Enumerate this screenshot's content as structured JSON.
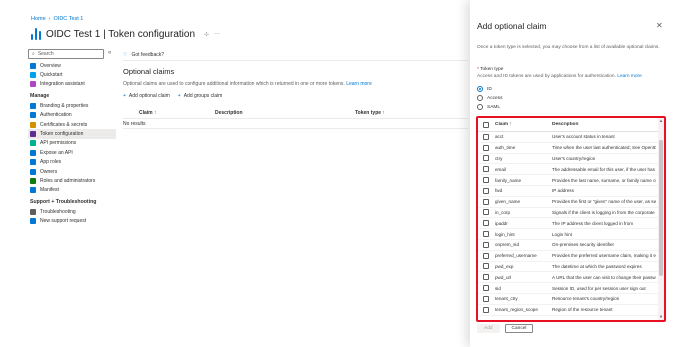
{
  "breadcrumb": [
    "Home",
    "OIDC Test 1"
  ],
  "page": {
    "app_name": "OIDC Test 1",
    "separator": "|",
    "section": "Token configuration",
    "pin_glyph": "⊹",
    "more_glyph": "···"
  },
  "sidebar": {
    "search_placeholder": "Search",
    "collapse_glyph": "«",
    "top_items": [
      {
        "label": "Overview",
        "color": "#0078d4"
      },
      {
        "label": "Quickstart",
        "color": "#00a2ed"
      },
      {
        "label": "Integration assistant",
        "color": "#b146c2"
      }
    ],
    "manage_label": "Manage",
    "manage_items": [
      {
        "label": "Branding & properties",
        "color": "#0078d4"
      },
      {
        "label": "Authentication",
        "color": "#0078d4"
      },
      {
        "label": "Certificates & secrets",
        "color": "#d29200"
      },
      {
        "label": "Token configuration",
        "color": "#5c2d91",
        "active": true
      },
      {
        "label": "API permissions",
        "color": "#00b294"
      },
      {
        "label": "Expose an API",
        "color": "#0078d4"
      },
      {
        "label": "App roles",
        "color": "#0078d4"
      },
      {
        "label": "Owners",
        "color": "#0078d4"
      },
      {
        "label": "Roles and administrators",
        "color": "#107c10"
      },
      {
        "label": "Manifest",
        "color": "#0078d4"
      }
    ],
    "support_label": "Support + Troubleshooting",
    "support_items": [
      {
        "label": "Troubleshooting",
        "color": "#605e5c"
      },
      {
        "label": "New support request",
        "color": "#0078d4"
      }
    ]
  },
  "main": {
    "feedback_label": "Got feedback?",
    "title": "Optional claims",
    "description": "Optional claims are used to configure additional information which is returned in one or more tokens.",
    "learn_more": "Learn more",
    "add_claim": "Add optional claim",
    "add_groups": "Add groups claim",
    "columns": [
      "Claim ↑",
      "Description",
      "Token type ↑"
    ],
    "empty_text": "No results"
  },
  "panel": {
    "title": "Add optional claim",
    "close_glyph": "✕",
    "description": "Once a token type is selected, you may choose from a list of available optional claims.",
    "token_type_label": "Token type",
    "token_type_help": "Access and ID tokens are used by applications for authentication.",
    "learn_more": "Learn more",
    "token_types": [
      {
        "label": "ID",
        "checked": true
      },
      {
        "label": "Access",
        "checked": false
      },
      {
        "label": "SAML",
        "checked": false
      }
    ],
    "claims_header": {
      "claim": "Claim ↑",
      "description": "Description"
    },
    "claims": [
      {
        "name": "acct",
        "description": "User's account status in tenant"
      },
      {
        "name": "auth_time",
        "description": "Time when the user last authenticated; See OpenID Con..."
      },
      {
        "name": "ctry",
        "description": "User's country/region"
      },
      {
        "name": "email",
        "description": "The addressable email for this user, if the user has one"
      },
      {
        "name": "family_name",
        "description": "Provides the last name, surname, or family name of the ..."
      },
      {
        "name": "fwd",
        "description": "IP address"
      },
      {
        "name": "given_name",
        "description": "Provides the first or \"given\" name of the user, as set on..."
      },
      {
        "name": "in_corp",
        "description": "Signals if the client is logging in from the corporate net..."
      },
      {
        "name": "ipaddr",
        "description": "The IP address the client logged in from"
      },
      {
        "name": "login_hint",
        "description": "Login hint"
      },
      {
        "name": "onprem_sid",
        "description": "On-premises security identifier"
      },
      {
        "name": "preferred_username",
        "description": "Provides the preferred username claim, making it easier..."
      },
      {
        "name": "pwd_exp",
        "description": "The datetime at which the password expires"
      },
      {
        "name": "pwd_url",
        "description": "A URL that the user can visit to change their password"
      },
      {
        "name": "sid",
        "description": "Session ID, used for per session user sign out"
      },
      {
        "name": "tenant_ctry",
        "description": "Resource tenant's country/region"
      },
      {
        "name": "tenant_region_scope",
        "description": "Region of the resource tenant"
      }
    ],
    "add_button": "Add",
    "cancel_button": "Cancel",
    "highlight_color": "#e81123"
  }
}
